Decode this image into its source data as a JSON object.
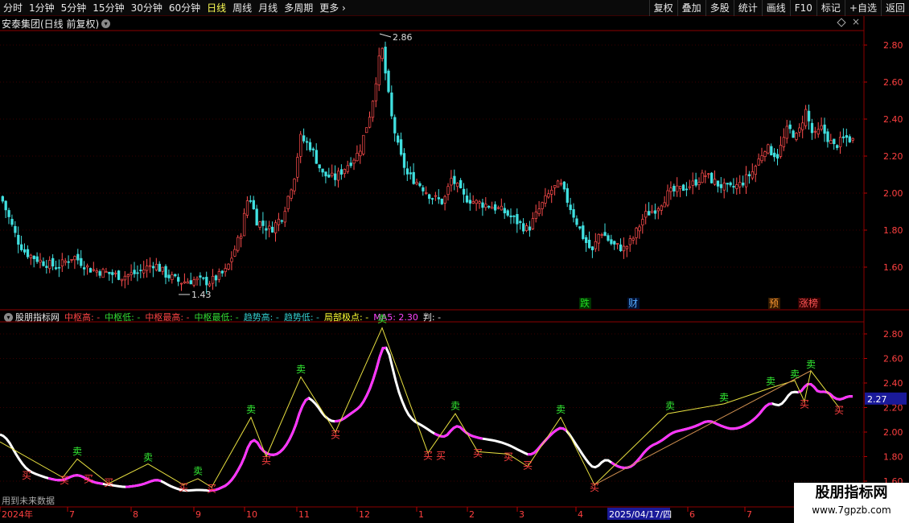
{
  "toolbar": {
    "left_items": [
      "分时",
      "1分钟",
      "5分钟",
      "15分钟",
      "30分钟",
      "60分钟",
      "日线",
      "周线",
      "月线",
      "多周期",
      "更多"
    ],
    "active": "日线",
    "right_items": [
      "复权",
      "叠加",
      "多股",
      "统计",
      "画线",
      "F10",
      "标记",
      "+自选",
      "返回"
    ]
  },
  "panel1": {
    "title": "安泰集团(日线 前复权)",
    "high_label": "2.86",
    "low_label": "1.43",
    "markers": [
      {
        "text": "跌",
        "color": "#22dd22",
        "bg": "#003300"
      },
      {
        "text": "财",
        "color": "#55aaff",
        "bg": "#001133"
      },
      {
        "text": "预",
        "color": "#ff9933",
        "bg": "#331a00"
      },
      {
        "text": "涨榜",
        "color": "#ff5555",
        "bg": "#330000"
      }
    ],
    "y_ticks": [
      "2.80",
      "2.60",
      "2.40",
      "2.20",
      "2.00",
      "1.80",
      "1.60"
    ]
  },
  "panel2": {
    "legend": [
      {
        "text": "股朋指标网",
        "color": "#e8e8e8"
      },
      {
        "text": "中枢高: -",
        "color": "#ff4444"
      },
      {
        "text": "中枢低: -",
        "color": "#33dd33"
      },
      {
        "text": "中枢最高: -",
        "color": "#ff4444"
      },
      {
        "text": "中枢最低: -",
        "color": "#33dd33"
      },
      {
        "text": "趋势高: -",
        "color": "#33cccc"
      },
      {
        "text": "趋势低: -",
        "color": "#33cccc"
      },
      {
        "text": "局部极点: -",
        "color": "#ffff33"
      },
      {
        "text": "MA5: 2.30",
        "color": "#ff44ff"
      },
      {
        "text": "判: -",
        "color": "#e8e8e8"
      }
    ],
    "y_ticks": [
      "2.80",
      "2.60",
      "2.40",
      "2.20",
      "2.00",
      "1.80",
      "1.60"
    ],
    "current_value": "2.27",
    "buy_label": "买",
    "sell_label": "卖"
  },
  "x_axis": {
    "labels": [
      "2024年",
      "7",
      "8",
      "9",
      "10",
      "11",
      "12",
      "1",
      "2",
      "3",
      "4",
      "2025/04/17/四",
      "6",
      "7"
    ]
  },
  "future_note": "用到未来数据",
  "watermark": {
    "title": "股朋指标网",
    "url": "www.7gpzb.com"
  }
}
